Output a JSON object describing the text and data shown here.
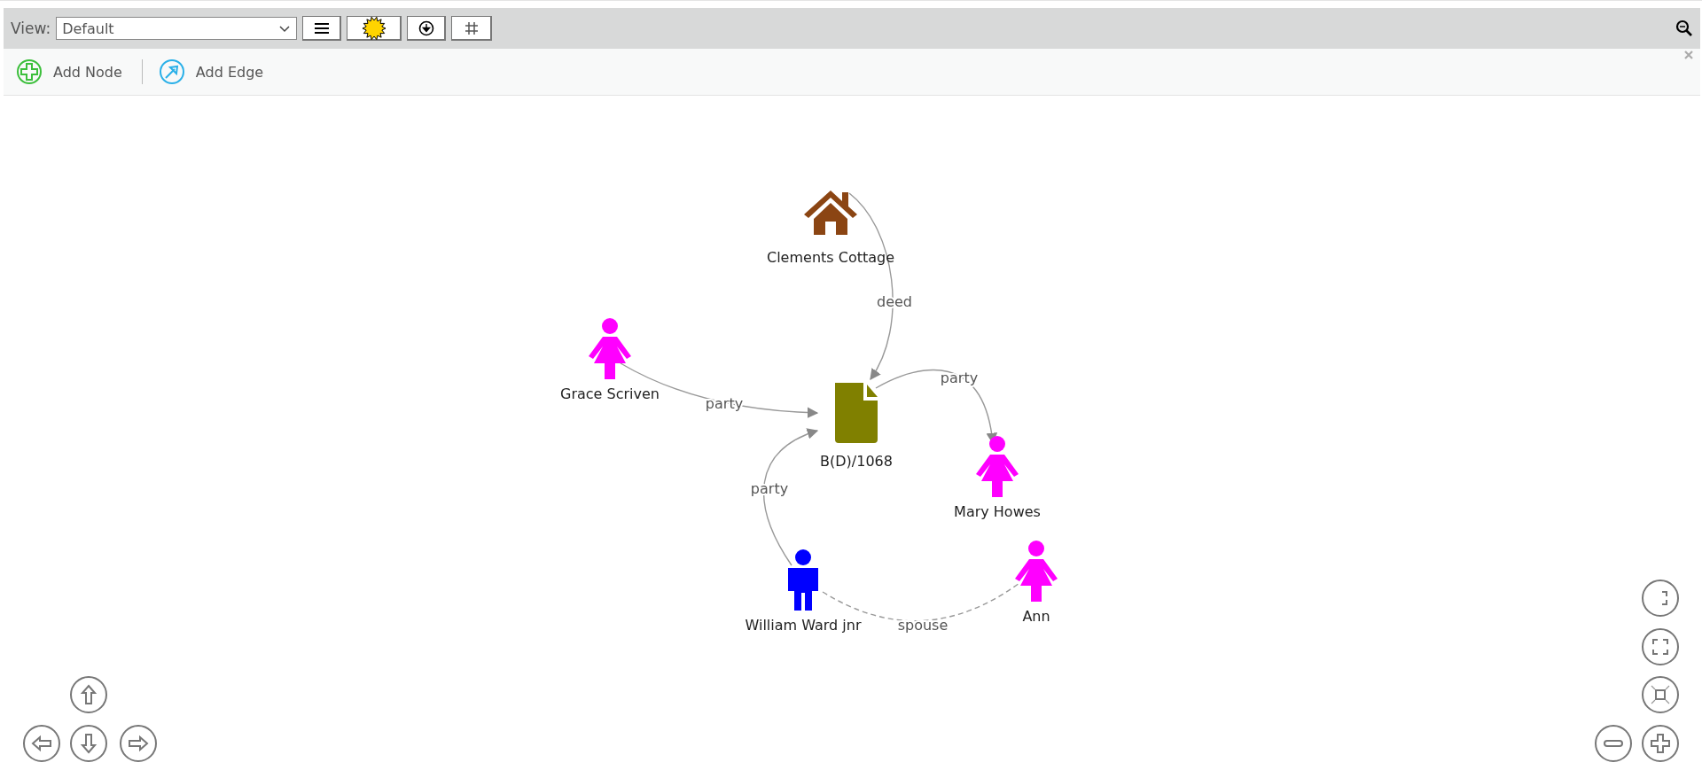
{
  "view_bar": {
    "label": "View:",
    "value": "Default"
  },
  "actions": [
    {
      "kind": "add-node",
      "label": "Add Node"
    },
    {
      "kind": "add-edge",
      "label": "Add Edge"
    }
  ],
  "graph": {
    "nodes": [
      {
        "kind": "house",
        "label": "Clements Cottage",
        "color": "#8b4513"
      },
      {
        "kind": "female",
        "label": "Grace Scriven",
        "color": "#ff00ff"
      },
      {
        "kind": "document",
        "label": "B(D)/1068",
        "color": "#808000"
      },
      {
        "kind": "female",
        "label": "Mary Howes",
        "color": "#ff00ff"
      },
      {
        "kind": "male",
        "label": "William Ward jnr",
        "color": "#0000ff"
      },
      {
        "kind": "female",
        "label": "Ann",
        "color": "#ff00ff"
      }
    ],
    "edges": [
      {
        "label": "deed",
        "dashed": false,
        "arrow": true
      },
      {
        "label": "party",
        "dashed": false,
        "arrow": true
      },
      {
        "label": "party",
        "dashed": false,
        "arrow": true
      },
      {
        "label": "party",
        "dashed": false,
        "arrow": true
      },
      {
        "label": "spouse",
        "dashed": true,
        "arrow": false
      }
    ]
  }
}
